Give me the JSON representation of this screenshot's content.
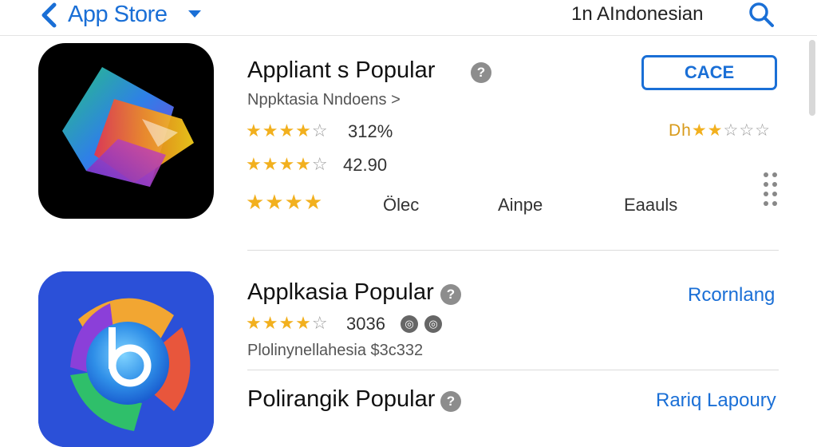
{
  "header": {
    "back_icon": "chevron-left-icon",
    "title": "App Store",
    "region": "1n AIndonesian",
    "search_icon": "search-icon"
  },
  "apps": [
    {
      "title": "Appliant  s Popular",
      "subtitle": "Nppktasia Nndoens >",
      "ratings": [
        {
          "stars": "★★★★",
          "empty": "☆",
          "value": "312%"
        },
        {
          "stars": "★★★★",
          "empty": "☆",
          "value": "42.90"
        },
        {
          "stars": "★★★★",
          "empty": "",
          "value": ""
        }
      ],
      "right_label": "Dh",
      "right_stars": "★★",
      "right_empty": "☆☆☆",
      "meta": [
        "Ölec",
        "Ainpe",
        "Eaauls"
      ],
      "button_label": "CACE"
    },
    {
      "title": "Applkasia Popular",
      "rating_stars": "★★★★",
      "rating_empty": "☆",
      "rating_value": "3036",
      "badges": [
        "◎",
        "◎"
      ],
      "subtitle": "Plolinynellahesia $3c332",
      "link": "Rcornlang"
    },
    {
      "title": "Polirangik Popular",
      "link": "Rariq Lapoury"
    }
  ],
  "colors": {
    "accent": "#1a6fd6",
    "star": "#f2b01e"
  }
}
